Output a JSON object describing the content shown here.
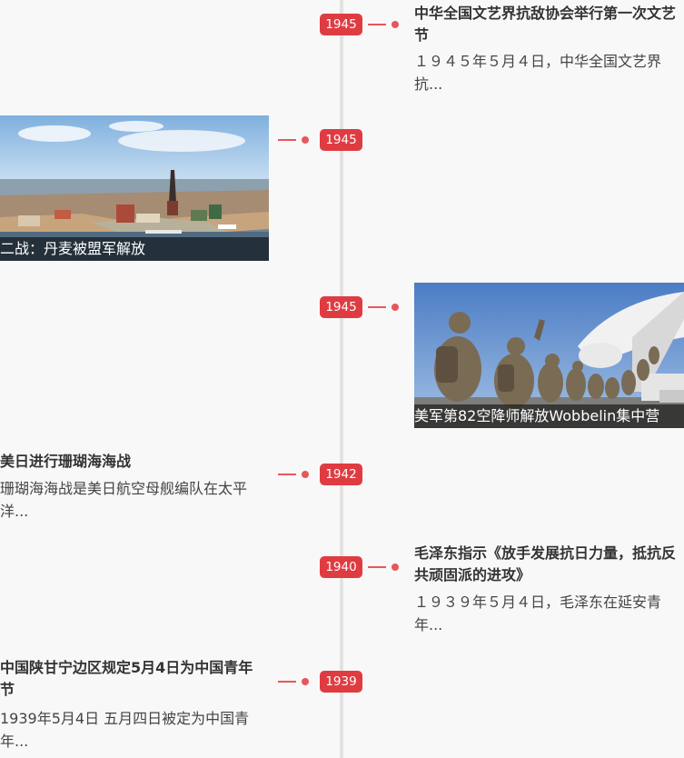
{
  "timeline": {
    "items": [
      {
        "year": "1945",
        "title": "中华全国文艺界抗敌协会举行第一次文艺节",
        "desc": "１９４５年５月４日，中华全国文艺界抗..."
      },
      {
        "year": "1945",
        "caption": "二战：丹麦被盟军解放",
        "image_icon": "city-aerial-photo"
      },
      {
        "year": "1945",
        "caption": "美军第82空降师解放Wobbelin集中营",
        "image_icon": "soldiers-boarding-plane-photo"
      },
      {
        "year": "1942",
        "title": "美日进行珊瑚海海战",
        "desc": "珊瑚海海战是美日航空母舰编队在太平洋..."
      },
      {
        "year": "1940",
        "title": "毛泽东指示《放手发展抗日力量，抵抗反共顽固派的进攻》",
        "desc": "１９３９年５月４日，毛泽东在延安青年..."
      },
      {
        "year": "1939",
        "title": "中国陕甘宁边区规定5月4日为中国青年节",
        "desc": "1939年5月4日 五月四日被定为中国青年..."
      }
    ]
  },
  "colors": {
    "accent": "#df3c42",
    "axis": "#e2e2e2",
    "background": "#f8f8f8"
  }
}
